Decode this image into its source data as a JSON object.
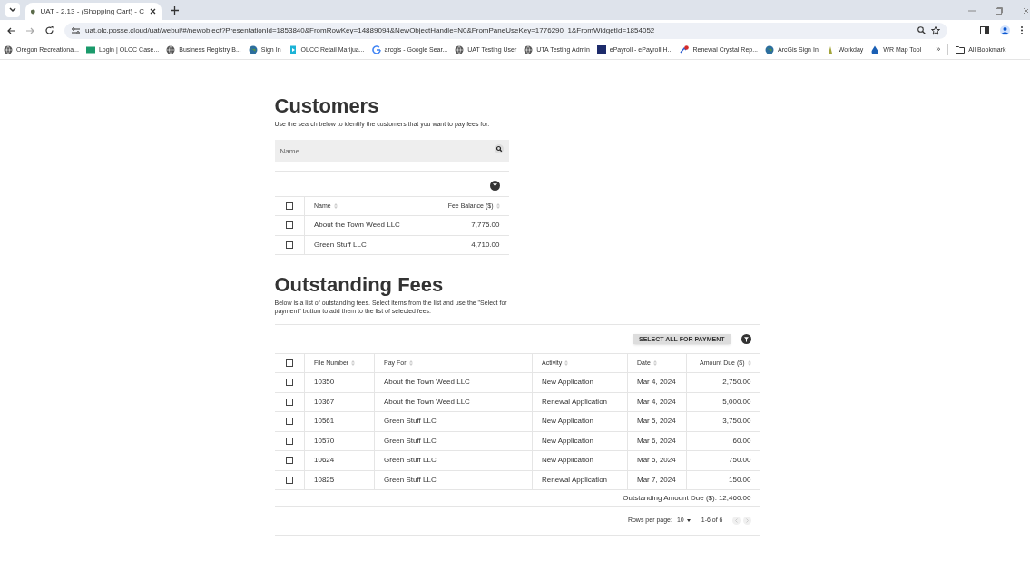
{
  "browser": {
    "tab": {
      "title": "UAT - 2.13 - (Shopping Cart) - C"
    },
    "url": "uat.olc.posse.cloud/uat/webui/#/newobject?PresentationId=1853840&FromRowKey=14889094&NewObjectHandle=N0&FromPaneUseKey=1776290_1&FromWidgetId=1854052",
    "bookmarks": [
      {
        "label": "Oregon Recreationa...",
        "kind": "globe"
      },
      {
        "label": "Login | OLCC Case...",
        "kind": "green"
      },
      {
        "label": "Business Registry B...",
        "kind": "globe"
      },
      {
        "label": "Sign In",
        "kind": "earth"
      },
      {
        "label": "OLCC Retail Marijua...",
        "kind": "cyan"
      },
      {
        "label": "arcgis - Google Sear...",
        "kind": "google"
      },
      {
        "label": "UAT Testing User",
        "kind": "globe"
      },
      {
        "label": "UTA Testing Admin",
        "kind": "globe"
      },
      {
        "label": "ePayroll - ePayroll H...",
        "kind": "navy"
      },
      {
        "label": "Renewal Crystal Rep...",
        "kind": "red"
      },
      {
        "label": "ArcGis Sign In",
        "kind": "earth"
      },
      {
        "label": "Workday",
        "kind": "yellow"
      },
      {
        "label": "WR Map Tool",
        "kind": "drop"
      }
    ],
    "overflow": "»",
    "all_bookmarks": "All Bookmark"
  },
  "customers": {
    "title": "Customers",
    "description": "Use the search below to identify the customers that you want to pay fees for.",
    "search": {
      "placeholder": "Name"
    },
    "table": {
      "select_all_checked": false,
      "columns": [
        "Name",
        "Fee Balance ($)"
      ],
      "rows": [
        {
          "name": "About the Town Weed LLC",
          "fee_balance": "7,775.00",
          "checked": false
        },
        {
          "name": "Green Stuff LLC",
          "fee_balance": "4,710.00",
          "checked": false
        }
      ]
    }
  },
  "outstanding_fees": {
    "title": "Outstanding Fees",
    "description": "Below is a list of outstanding fees. Select items from the list and use the \"Select for payment\" button to add them to the list of selected fees.",
    "select_all_button": "SELECT ALL FOR PAYMENT",
    "table": {
      "select_all_checked": false,
      "columns": [
        "File Number",
        "Pay For",
        "Activity",
        "Date",
        "Amount Due ($)"
      ],
      "rows": [
        {
          "file_number": "10350",
          "pay_for": "About the Town Weed LLC",
          "activity": "New Application",
          "date": "Mar 4, 2024",
          "amount_due": "2,750.00",
          "checked": false
        },
        {
          "file_number": "10367",
          "pay_for": "About the Town Weed LLC",
          "activity": "Renewal Application",
          "date": "Mar 4, 2024",
          "amount_due": "5,000.00",
          "checked": false
        },
        {
          "file_number": "10561",
          "pay_for": "Green Stuff LLC",
          "activity": "New Application",
          "date": "Mar 5, 2024",
          "amount_due": "3,750.00",
          "checked": false
        },
        {
          "file_number": "10570",
          "pay_for": "Green Stuff LLC",
          "activity": "New Application",
          "date": "Mar 6, 2024",
          "amount_due": "60.00",
          "checked": false
        },
        {
          "file_number": "10624",
          "pay_for": "Green Stuff LLC",
          "activity": "New Application",
          "date": "Mar 5, 2024",
          "amount_due": "750.00",
          "checked": false
        },
        {
          "file_number": "10825",
          "pay_for": "Green Stuff LLC",
          "activity": "Renewal Application",
          "date": "Mar 7, 2024",
          "amount_due": "150.00",
          "checked": false
        }
      ]
    },
    "total_label": "Outstanding Amount Due ($):",
    "total_value": "12,460.00",
    "pagination": {
      "rows_per_page_label": "Rows per page:",
      "rows_per_page": "10",
      "range": "1-6 of 6"
    }
  }
}
